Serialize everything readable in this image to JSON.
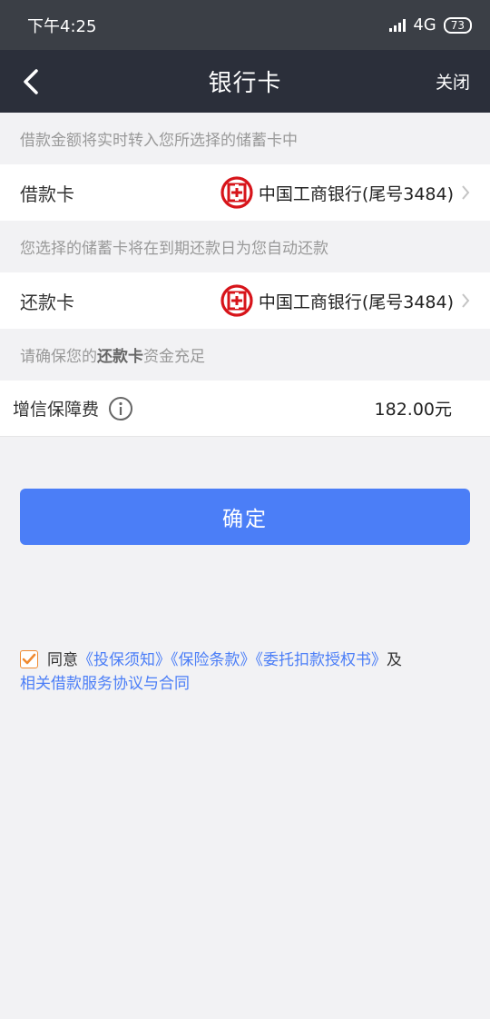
{
  "status": {
    "time": "下午4:25",
    "network": "4G",
    "battery": "73"
  },
  "nav": {
    "title": "银行卡",
    "close": "关闭"
  },
  "sections": {
    "loan_hint": "借款金额将实时转入您所选择的储蓄卡中",
    "loan_label": "借款卡",
    "loan_bank": "中国工商银行(尾号3484)",
    "repay_hint": "您选择的储蓄卡将在到期还款日为您自动还款",
    "repay_label": "还款卡",
    "repay_bank": "中国工商银行(尾号3484)",
    "funds_hint_prefix": "请确保您的",
    "funds_hint_bold": "还款卡",
    "funds_hint_suffix": "资金充足"
  },
  "fee": {
    "label": "增信保障费",
    "value": "182.00元"
  },
  "confirm": "确定",
  "agreement": {
    "prefix": "同意",
    "link1": "《投保须知》",
    "link2": "《保险条款》",
    "link3": "《委托扣款授权书》",
    "mid": "及",
    "link4": "相关借款服务协议与合同",
    "checked": true
  },
  "colors": {
    "accent": "#4b7ef7",
    "bank_logo": "#d7141a",
    "checkbox": "#f08a30",
    "nav_bg": "#2b2f3a"
  },
  "icons": {
    "back": "chevron-left-icon",
    "bank": "icbc-logo-icon",
    "arrow": "chevron-right-icon",
    "info": "info-circle-icon",
    "check": "checkmark-icon"
  }
}
